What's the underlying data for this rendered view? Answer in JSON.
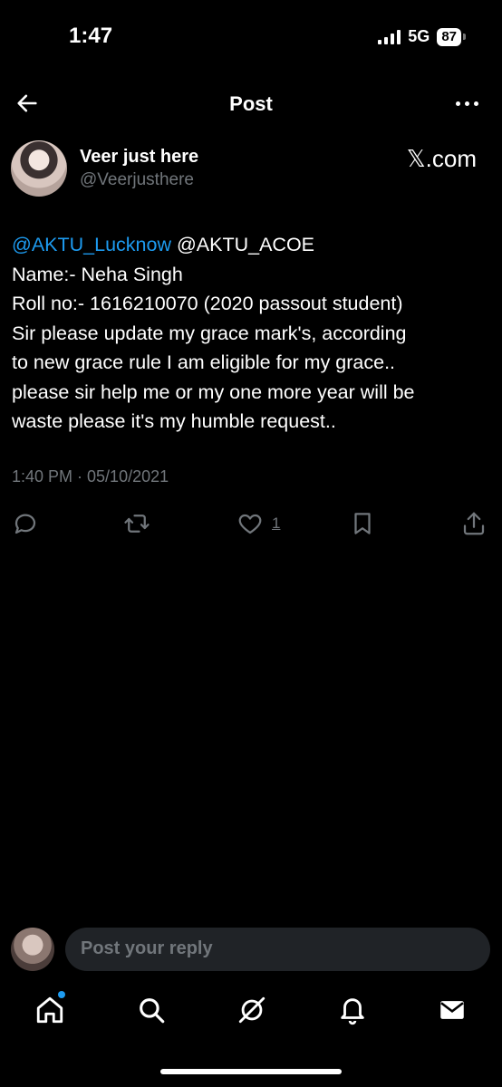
{
  "status_bar": {
    "time": "1:47",
    "network": "5G",
    "battery": "87"
  },
  "header": {
    "title": "Post"
  },
  "author": {
    "name": "Veer just here",
    "handle": "@Veerjusthere",
    "site": "𝕏.com"
  },
  "post": {
    "mention1": "@AKTU_Lucknow",
    "mention2": "@AKTU_ACOE",
    "line2": "Name:- Neha Singh",
    "line3": "Roll no:- 1616210070 (2020 passout student)",
    "line4": "Sir please update my grace mark's, according",
    "line5": "to new grace rule I am eligible for my grace..",
    "line6": "please sir help me or my one more year will be",
    "line7": "waste please it's my humble request..",
    "timestamp": "1:40 PM · 05/10/2021"
  },
  "actions": {
    "like_count": "1",
    "icons": [
      "reply-icon",
      "repost-icon",
      "like-icon",
      "bookmark-icon",
      "share-icon"
    ]
  },
  "reply": {
    "placeholder": "Post your reply"
  },
  "nav": {
    "icons": [
      "home-icon",
      "search-icon",
      "grok-icon",
      "notifications-icon",
      "messages-icon"
    ]
  },
  "colors": {
    "accent": "#1d9bf0",
    "muted": "#71767b",
    "background": "#000000"
  }
}
